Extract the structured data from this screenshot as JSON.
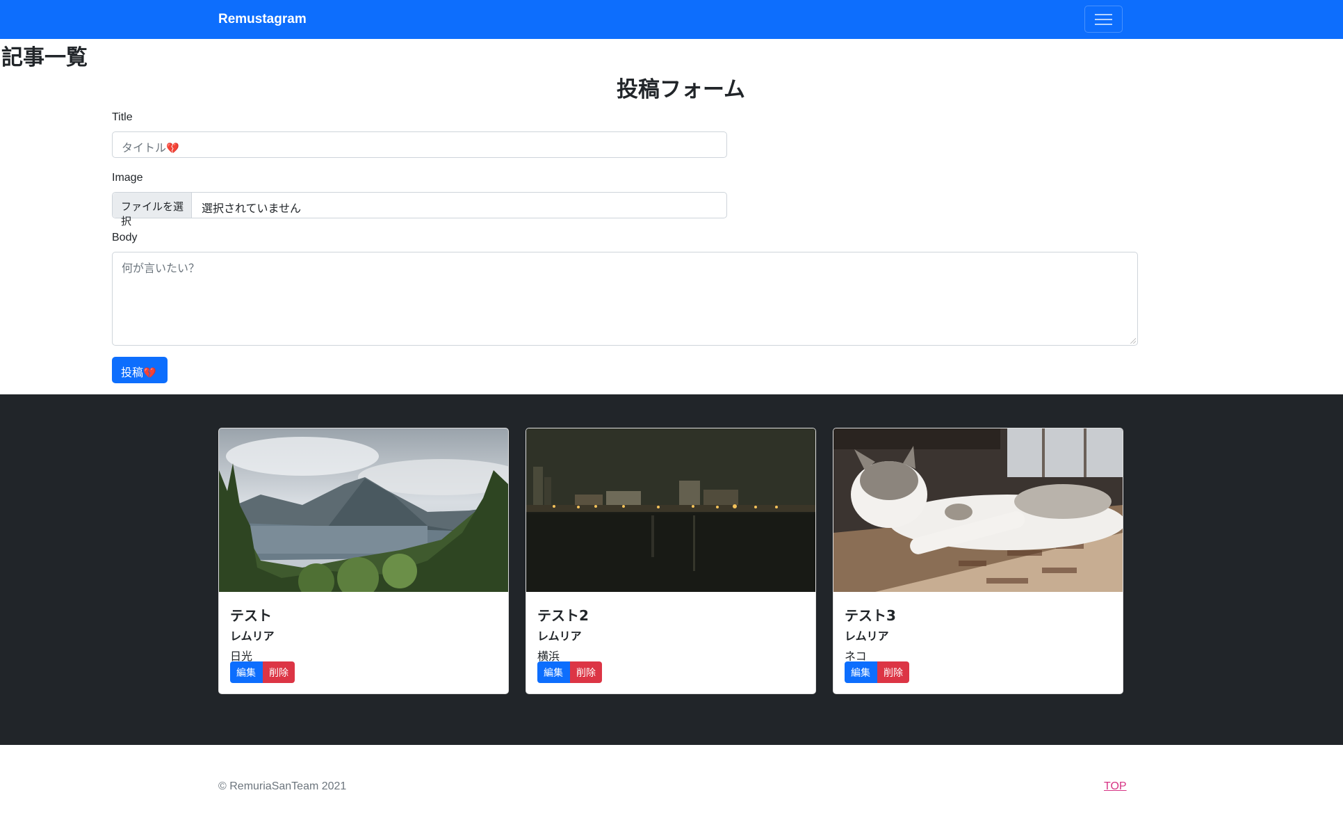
{
  "navbar": {
    "brand": "Remustagram",
    "toggle_icon": "hamburger-icon",
    "color": "#0d6efd"
  },
  "page_title": "記事一覧",
  "form": {
    "title": "投稿フォーム",
    "title_label": "Title",
    "title_placeholder": "タイトル",
    "image_label": "Image",
    "file_button": "ファイルを選択",
    "file_status": "選択されていません",
    "body_label": "Body",
    "body_placeholder": "何が言いたい？",
    "submit_label": "投稿",
    "heart_icon": "broken-heart-icon"
  },
  "posts": [
    {
      "title": "テスト",
      "author": "レムリア",
      "body": "日光",
      "edit_label": "編集",
      "delete_label": "削除",
      "image_subject": "mountain-lake"
    },
    {
      "title": "テスト2",
      "author": "レムリア",
      "body": "横浜",
      "edit_label": "編集",
      "delete_label": "削除",
      "image_subject": "night-harbor"
    },
    {
      "title": "テスト3",
      "author": "レムリア",
      "body": "ネコ",
      "edit_label": "編集",
      "delete_label": "削除",
      "image_subject": "sleeping-cat"
    }
  ],
  "footer": {
    "copyright": "© RemuriaSanTeam 2021",
    "top_link": "TOP"
  },
  "colors": {
    "primary": "#0d6efd",
    "danger": "#dc3545",
    "dark": "#212529",
    "link": "#d63384"
  }
}
